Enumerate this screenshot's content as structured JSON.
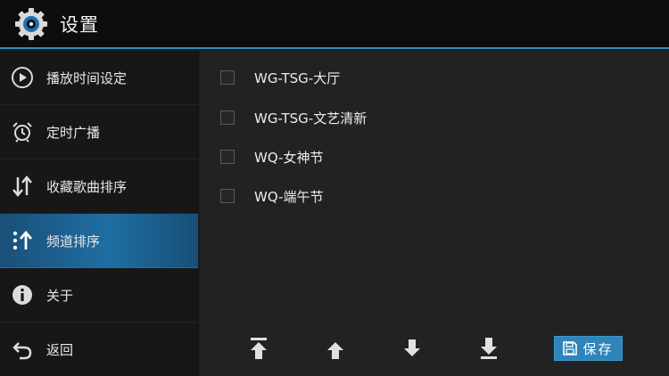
{
  "app": {
    "title": "设置",
    "icon": "gear-icon",
    "accent_color": "#2a8fc4"
  },
  "sidebar": {
    "items": [
      {
        "label": "播放时间设定",
        "icon": "play-circle-icon",
        "active": false
      },
      {
        "label": "定时广播",
        "icon": "alarm-clock-icon",
        "active": false
      },
      {
        "label": "收藏歌曲排序",
        "icon": "sort-arrows-icon",
        "active": false
      },
      {
        "label": "频道排序",
        "icon": "channel-sort-icon",
        "active": true
      },
      {
        "label": "关于",
        "icon": "info-icon",
        "active": false
      },
      {
        "label": "返回",
        "icon": "back-arrow-icon",
        "active": false
      }
    ]
  },
  "channels": [
    {
      "label": "WG-TSG-大厅",
      "checked": false
    },
    {
      "label": "WG-TSG-文艺清新",
      "checked": false
    },
    {
      "label": "WQ-女神节",
      "checked": false
    },
    {
      "label": "WQ-端午节",
      "checked": false
    }
  ],
  "toolbar": {
    "move_top_icon": "move-to-top-icon",
    "move_up_icon": "arrow-up-icon",
    "move_down_icon": "arrow-down-icon",
    "move_bottom_icon": "move-to-bottom-icon",
    "save_label": "保存",
    "save_icon": "floppy-disk-icon"
  }
}
